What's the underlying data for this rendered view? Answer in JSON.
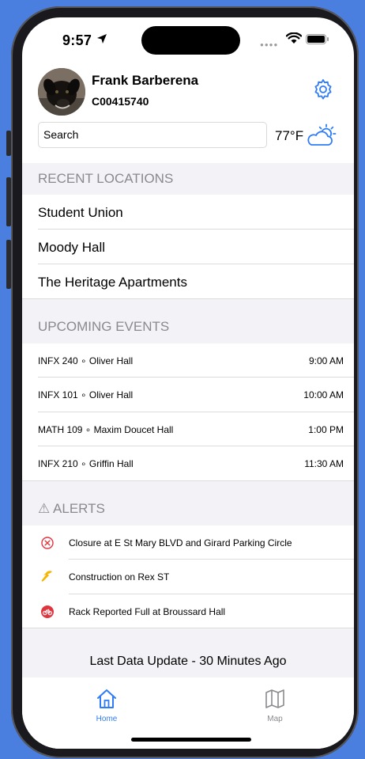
{
  "status": {
    "time": "9:57"
  },
  "profile": {
    "name": "Frank Barberena",
    "id": "C00415740"
  },
  "search": {
    "placeholder": "Search"
  },
  "weather": {
    "temp": "77°F",
    "icon": "partly-cloudy-icon"
  },
  "recent": {
    "header": "RECENT LOCATIONS",
    "items": [
      {
        "label": "Student Union"
      },
      {
        "label": "Moody Hall"
      },
      {
        "label": "The Heritage Apartments"
      }
    ]
  },
  "events": {
    "header": "UPCOMING EVENTS",
    "items": [
      {
        "title": "INFX 240 ∘ Oliver Hall",
        "time": "9:00 AM"
      },
      {
        "title": "INFX 101 ∘ Oliver Hall",
        "time": "10:00 AM"
      },
      {
        "title": "MATH 109 ∘ Maxim Doucet Hall",
        "time": "1:00 PM"
      },
      {
        "title": "INFX 210 ∘ Griffin Hall",
        "time": "11:30 AM"
      }
    ]
  },
  "alerts": {
    "header": "⚠ ALERTS",
    "items": [
      {
        "text": "Closure at E St Mary BLVD and Girard Parking Circle",
        "icon": "closure-icon"
      },
      {
        "text": "Construction on Rex ST",
        "icon": "hammer-icon"
      },
      {
        "text": "Rack Reported Full at Broussard Hall",
        "icon": "bike-icon"
      }
    ]
  },
  "footer": {
    "text": "Last Data Update - 30 Minutes Ago"
  },
  "tabs": [
    {
      "label": "Home",
      "icon": "home-icon",
      "active": true
    },
    {
      "label": "Map",
      "icon": "map-icon",
      "active": false
    }
  ],
  "colors": {
    "accent": "#2f7cf6",
    "section_bg": "#f2f2f7",
    "alert_red": "#e0343e",
    "alert_yellow": "#f4b400"
  }
}
